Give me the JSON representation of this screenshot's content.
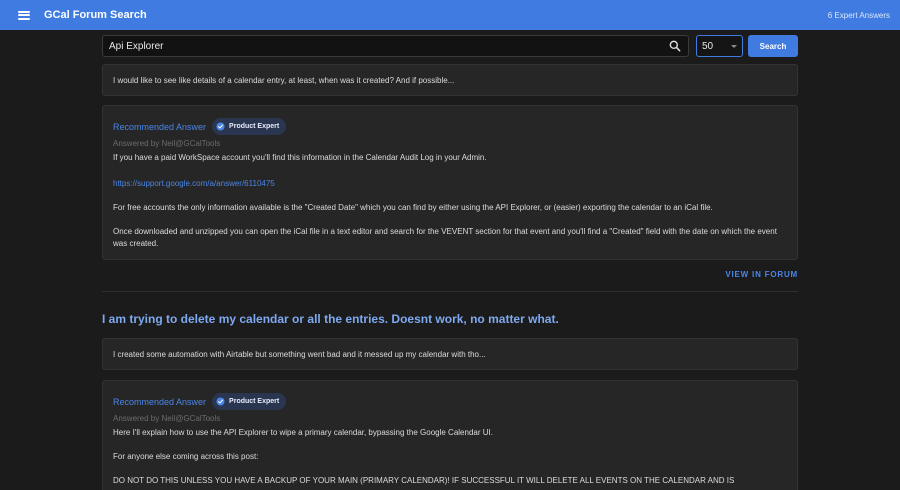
{
  "appbar": {
    "title": "GCal Forum Search",
    "count": "6 Expert Answers"
  },
  "search": {
    "query": "Api Explorer",
    "result_count": "50",
    "button_label": "Search"
  },
  "thread1": {
    "question": "I would like to see like details of a calendar entry, at least, when was it created? And if possible...",
    "rec_label": "Recommended Answer",
    "badge": "Product Expert",
    "answered_by": "Answered by Neil@GCalTools",
    "p1": "If you have a paid WorkSpace account you'll find this information in the Calendar Audit Log in your Admin.",
    "link": "https://support.google.com/a/answer/6110475",
    "p2": "For free accounts the only information available is the \"Created Date\" which you can find by either using the API Explorer, or (easier) exporting the calendar to an iCal file.",
    "p3": "Once downloaded and unzipped you can open the iCal file in a text editor and search for the VEVENT section for that event and you'll find a \"Created\" field with the date on which the event was created.",
    "view_label": "VIEW IN FORUM"
  },
  "thread2": {
    "title": "I am trying to delete my calendar or all the entries. Doesnt work, no matter what.",
    "question": "I created some automation with Airtable but something went bad and it messed up my calendar with tho...",
    "rec_label": "Recommended Answer",
    "badge": "Product Expert",
    "answered_by": "Answered by Neil@GCalTools",
    "p1": "Here I'll explain how to use the API Explorer to wipe a primary calendar, bypassing the Google Calendar UI.",
    "p2": "For anyone else coming across this post:",
    "p3": "DO NOT DO THIS UNLESS YOU HAVE A BACKUP OF YOUR MAIN (PRIMARY CALENDAR)! IF SUCCESSFUL IT WILL DELETE ALL EVENTS ON THE CALENDAR AND IS"
  },
  "colors": {
    "appbar": "#3f7be0",
    "background": "#1b1b1b",
    "card": "#262626",
    "link": "#4a86e8",
    "title": "#7ea8ef"
  },
  "icons": {
    "menu": "hamburger-menu-icon",
    "search": "search-icon",
    "badge": "verified-check-icon",
    "dropdown": "chevron-down-icon"
  }
}
